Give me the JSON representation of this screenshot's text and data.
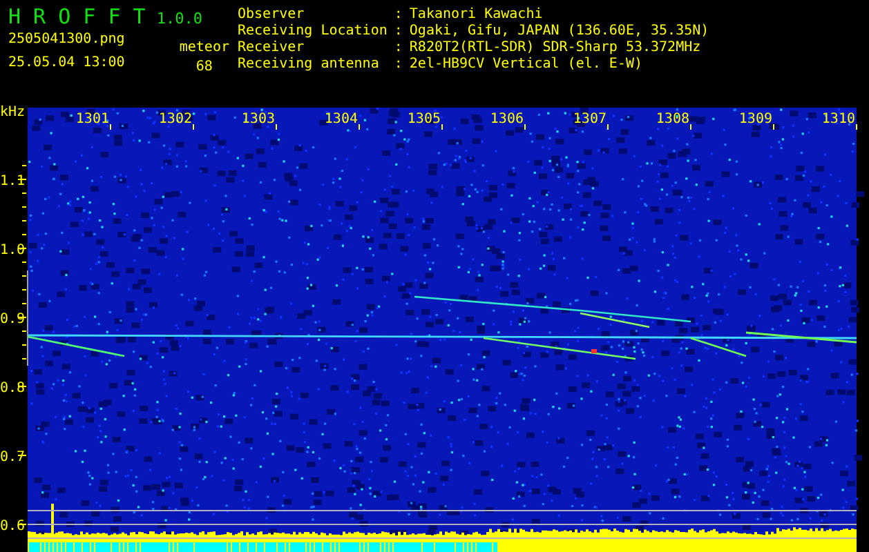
{
  "app": {
    "title": "H R O F F T",
    "version": "1.0.0"
  },
  "capture": {
    "filename": "2505041300.png",
    "timestamp": "25.05.04 13:00",
    "count_label": "meteor",
    "count": "68"
  },
  "info": {
    "separator": ":",
    "rows": [
      {
        "label": "Observer",
        "value": "Takanori Kawachi"
      },
      {
        "label": "Receiving Location",
        "value": "Ogaki, Gifu, JAPAN (136.60E, 35.35N)"
      },
      {
        "label": "Receiver",
        "value": "R820T2(RTL-SDR) SDR-Sharp 53.372MHz"
      },
      {
        "label": "Receiving antenna",
        "value": "2el-HB9CV Vertical (el. E-W)"
      }
    ]
  },
  "spectrogram": {
    "y_unit": "kHz",
    "time_labels": [
      "1301",
      "1302",
      "1303",
      "1304",
      "1305",
      "1306",
      "1307",
      "1308",
      "1309",
      "1310"
    ],
    "freq_labels": [
      "1.1",
      "1.0",
      "0.9",
      "0.8",
      "0.7",
      "0.6"
    ]
  }
}
